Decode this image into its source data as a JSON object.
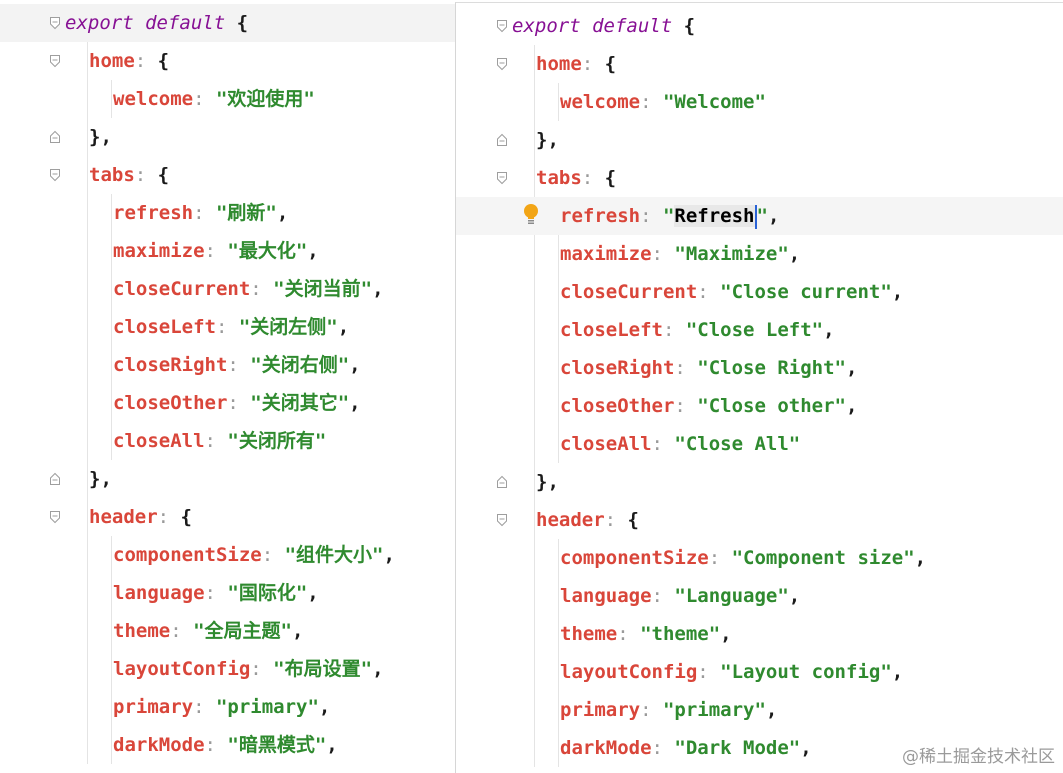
{
  "left_pane": {
    "lines": [
      [
        {
          "c": "kw",
          "t": "export default"
        },
        {
          "c": "punc",
          "t": " {"
        }
      ],
      [
        {
          "c": "key",
          "t": "home"
        },
        {
          "c": "colon",
          "t": ": "
        },
        {
          "c": "punc",
          "t": "{"
        }
      ],
      [
        {
          "c": "key",
          "t": "welcome"
        },
        {
          "c": "colon",
          "t": ": "
        },
        {
          "c": "str",
          "t": "\"欢迎使用\""
        }
      ],
      [
        {
          "c": "punc",
          "t": "},"
        }
      ],
      [
        {
          "c": "key",
          "t": "tabs"
        },
        {
          "c": "colon",
          "t": ": "
        },
        {
          "c": "punc",
          "t": "{"
        }
      ],
      [
        {
          "c": "key",
          "t": "refresh"
        },
        {
          "c": "colon",
          "t": ": "
        },
        {
          "c": "str",
          "t": "\"刷新\""
        },
        {
          "c": "punc",
          "t": ","
        }
      ],
      [
        {
          "c": "key",
          "t": "maximize"
        },
        {
          "c": "colon",
          "t": ": "
        },
        {
          "c": "str",
          "t": "\"最大化\""
        },
        {
          "c": "punc",
          "t": ","
        }
      ],
      [
        {
          "c": "key",
          "t": "closeCurrent"
        },
        {
          "c": "colon",
          "t": ": "
        },
        {
          "c": "str",
          "t": "\"关闭当前\""
        },
        {
          "c": "punc",
          "t": ","
        }
      ],
      [
        {
          "c": "key",
          "t": "closeLeft"
        },
        {
          "c": "colon",
          "t": ": "
        },
        {
          "c": "str",
          "t": "\"关闭左侧\""
        },
        {
          "c": "punc",
          "t": ","
        }
      ],
      [
        {
          "c": "key",
          "t": "closeRight"
        },
        {
          "c": "colon",
          "t": ": "
        },
        {
          "c": "str",
          "t": "\"关闭右侧\""
        },
        {
          "c": "punc",
          "t": ","
        }
      ],
      [
        {
          "c": "key",
          "t": "closeOther"
        },
        {
          "c": "colon",
          "t": ": "
        },
        {
          "c": "str",
          "t": "\"关闭其它\""
        },
        {
          "c": "punc",
          "t": ","
        }
      ],
      [
        {
          "c": "key",
          "t": "closeAll"
        },
        {
          "c": "colon",
          "t": ": "
        },
        {
          "c": "str",
          "t": "\"关闭所有\""
        }
      ],
      [
        {
          "c": "punc",
          "t": "},"
        }
      ],
      [
        {
          "c": "key",
          "t": "header"
        },
        {
          "c": "colon",
          "t": ": "
        },
        {
          "c": "punc",
          "t": "{"
        }
      ],
      [
        {
          "c": "key",
          "t": "componentSize"
        },
        {
          "c": "colon",
          "t": ": "
        },
        {
          "c": "str",
          "t": "\"组件大小\""
        },
        {
          "c": "punc",
          "t": ","
        }
      ],
      [
        {
          "c": "key",
          "t": "language"
        },
        {
          "c": "colon",
          "t": ": "
        },
        {
          "c": "str",
          "t": "\"国际化\""
        },
        {
          "c": "punc",
          "t": ","
        }
      ],
      [
        {
          "c": "key",
          "t": "theme"
        },
        {
          "c": "colon",
          "t": ": "
        },
        {
          "c": "str",
          "t": "\"全局主题\""
        },
        {
          "c": "punc",
          "t": ","
        }
      ],
      [
        {
          "c": "key",
          "t": "layoutConfig"
        },
        {
          "c": "colon",
          "t": ": "
        },
        {
          "c": "str",
          "t": "\"布局设置\""
        },
        {
          "c": "punc",
          "t": ","
        }
      ],
      [
        {
          "c": "key",
          "t": "primary"
        },
        {
          "c": "colon",
          "t": ": "
        },
        {
          "c": "str",
          "t": "\"primary\""
        },
        {
          "c": "punc",
          "t": ","
        }
      ],
      [
        {
          "c": "key",
          "t": "darkMode"
        },
        {
          "c": "colon",
          "t": ": "
        },
        {
          "c": "str",
          "t": "\"暗黑模式\""
        },
        {
          "c": "punc",
          "t": ","
        }
      ]
    ]
  },
  "right_pane": {
    "lines": [
      [
        {
          "c": "kw",
          "t": "export default"
        },
        {
          "c": "punc",
          "t": " {"
        }
      ],
      [
        {
          "c": "key",
          "t": "home"
        },
        {
          "c": "colon",
          "t": ": "
        },
        {
          "c": "punc",
          "t": "{"
        }
      ],
      [
        {
          "c": "key",
          "t": "welcome"
        },
        {
          "c": "colon",
          "t": ": "
        },
        {
          "c": "str",
          "t": "\"Welcome\""
        }
      ],
      [
        {
          "c": "punc",
          "t": "},"
        }
      ],
      [
        {
          "c": "key",
          "t": "tabs"
        },
        {
          "c": "colon",
          "t": ": "
        },
        {
          "c": "punc",
          "t": "{"
        }
      ],
      [
        {
          "c": "key",
          "t": "refresh"
        },
        {
          "c": "colon",
          "t": ": "
        },
        {
          "c": "str",
          "t": "\""
        },
        {
          "c": "sel",
          "t": "Refresh"
        },
        {
          "c": "caret",
          "t": ""
        },
        {
          "c": "str",
          "t": "\""
        },
        {
          "c": "punc",
          "t": ","
        }
      ],
      [
        {
          "c": "key",
          "t": "maximize"
        },
        {
          "c": "colon",
          "t": ": "
        },
        {
          "c": "str",
          "t": "\"Maximize\""
        },
        {
          "c": "punc",
          "t": ","
        }
      ],
      [
        {
          "c": "key",
          "t": "closeCurrent"
        },
        {
          "c": "colon",
          "t": ": "
        },
        {
          "c": "str",
          "t": "\"Close current\""
        },
        {
          "c": "punc",
          "t": ","
        }
      ],
      [
        {
          "c": "key",
          "t": "closeLeft"
        },
        {
          "c": "colon",
          "t": ": "
        },
        {
          "c": "str",
          "t": "\"Close Left\""
        },
        {
          "c": "punc",
          "t": ","
        }
      ],
      [
        {
          "c": "key",
          "t": "closeRight"
        },
        {
          "c": "colon",
          "t": ": "
        },
        {
          "c": "str",
          "t": "\"Close Right\""
        },
        {
          "c": "punc",
          "t": ","
        }
      ],
      [
        {
          "c": "key",
          "t": "closeOther"
        },
        {
          "c": "colon",
          "t": ": "
        },
        {
          "c": "str",
          "t": "\"Close other\""
        },
        {
          "c": "punc",
          "t": ","
        }
      ],
      [
        {
          "c": "key",
          "t": "closeAll"
        },
        {
          "c": "colon",
          "t": ": "
        },
        {
          "c": "str",
          "t": "\"Close All\""
        }
      ],
      [
        {
          "c": "punc",
          "t": "},"
        }
      ],
      [
        {
          "c": "key",
          "t": "header"
        },
        {
          "c": "colon",
          "t": ": "
        },
        {
          "c": "punc",
          "t": "{"
        }
      ],
      [
        {
          "c": "key",
          "t": "componentSize"
        },
        {
          "c": "colon",
          "t": ": "
        },
        {
          "c": "str",
          "t": "\"Component size\""
        },
        {
          "c": "punc",
          "t": ","
        }
      ],
      [
        {
          "c": "key",
          "t": "language"
        },
        {
          "c": "colon",
          "t": ": "
        },
        {
          "c": "str",
          "t": "\"Language\""
        },
        {
          "c": "punc",
          "t": ","
        }
      ],
      [
        {
          "c": "key",
          "t": "theme"
        },
        {
          "c": "colon",
          "t": ": "
        },
        {
          "c": "str",
          "t": "\"theme\""
        },
        {
          "c": "punc",
          "t": ","
        }
      ],
      [
        {
          "c": "key",
          "t": "layoutConfig"
        },
        {
          "c": "colon",
          "t": ": "
        },
        {
          "c": "str",
          "t": "\"Layout config\""
        },
        {
          "c": "punc",
          "t": ","
        }
      ],
      [
        {
          "c": "key",
          "t": "primary"
        },
        {
          "c": "colon",
          "t": ": "
        },
        {
          "c": "str",
          "t": "\"primary\""
        },
        {
          "c": "punc",
          "t": ","
        }
      ],
      [
        {
          "c": "key",
          "t": "darkMode"
        },
        {
          "c": "colon",
          "t": ": "
        },
        {
          "c": "str",
          "t": "\"Dark Mode\""
        },
        {
          "c": "punc",
          "t": ","
        }
      ]
    ]
  },
  "icons": {
    "fold_open": "fold-open-icon",
    "fold_close": "fold-close-icon",
    "intention": "lightbulb-icon"
  },
  "colors": {
    "keyword": "#871094",
    "property_key": "#d9463a",
    "string": "#2f8a2f",
    "selection": "#e8e8e8",
    "caret": "#2a63d6",
    "bulb": "#f2a516"
  },
  "watermark": "@稀土掘金技术社区"
}
